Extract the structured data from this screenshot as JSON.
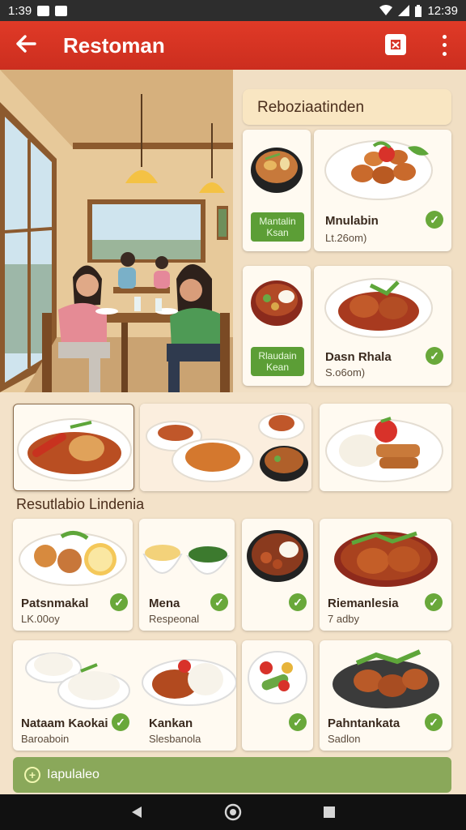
{
  "status": {
    "time": "1:39",
    "clock": "12:39"
  },
  "appbar": {
    "title": "Restoman"
  },
  "featured": {
    "header": "Reboziaatinden",
    "items": [
      {
        "btn": [
          "Mantalin",
          "Ksan"
        ],
        "name": "Mnulabin",
        "price": "Lt.26om)"
      },
      {
        "btn": [
          "Rlaudain",
          "Kean"
        ],
        "name": "Dasn Rhala",
        "price": "S.o6om)"
      }
    ]
  },
  "list_title": "Resutlabio Lindenia",
  "menu": [
    {
      "name": "Patsnmakal",
      "sub": "LK.00oy"
    },
    {
      "name": "Mena",
      "sub": "Respeonal"
    },
    {
      "name": "",
      "sub": ""
    },
    {
      "name": "Riemanlesia",
      "sub": "7 adby"
    },
    {
      "name": "Nataam Kaokai",
      "sub": "Baroaboin"
    },
    {
      "name": "Kankan",
      "sub": "Slesbanola"
    },
    {
      "name": "",
      "sub": ""
    },
    {
      "name": "Pahntankata",
      "sub": "Sadlon"
    }
  ],
  "bottom": {
    "label": "Iapulaleo"
  },
  "icons": [
    "back-arrow-icon",
    "action-icon",
    "more-vert-icon",
    "check-icon",
    "back-triangle-icon",
    "home-circle-icon",
    "recents-square-icon"
  ]
}
